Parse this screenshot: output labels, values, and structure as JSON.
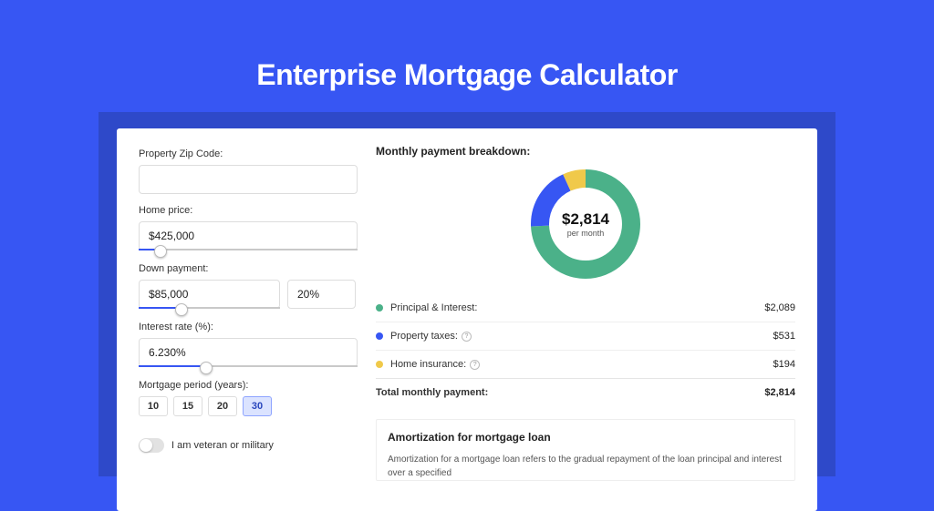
{
  "title": "Enterprise Mortgage Calculator",
  "form": {
    "zip": {
      "label": "Property Zip Code:",
      "value": ""
    },
    "price": {
      "label": "Home price:",
      "value": "$425,000",
      "slider_pct": 10
    },
    "down": {
      "label": "Down payment:",
      "amount": "$85,000",
      "pct": "20%",
      "slider_pct": 30
    },
    "rate": {
      "label": "Interest rate (%):",
      "value": "6.230%",
      "slider_pct": 31
    },
    "period": {
      "label": "Mortgage period (years):",
      "options": [
        "10",
        "15",
        "20",
        "30"
      ],
      "selected": "30"
    },
    "veteran": {
      "label": "I am veteran or military",
      "on": false
    }
  },
  "breakdown": {
    "title": "Monthly payment breakdown:",
    "center_amount": "$2,814",
    "center_sub": "per month",
    "items": [
      {
        "label": "Principal & Interest:",
        "value": "$2,089",
        "color": "#4bb189",
        "info": false
      },
      {
        "label": "Property taxes:",
        "value": "$531",
        "color": "#3756f3",
        "info": true
      },
      {
        "label": "Home insurance:",
        "value": "$194",
        "color": "#f0c94a",
        "info": true
      }
    ],
    "total": {
      "label": "Total monthly payment:",
      "value": "$2,814"
    }
  },
  "chart_data": {
    "type": "pie",
    "title": "Monthly payment breakdown",
    "series": [
      {
        "name": "Principal & Interest",
        "value": 2089,
        "color": "#4bb189"
      },
      {
        "name": "Property taxes",
        "value": 531,
        "color": "#3756f3"
      },
      {
        "name": "Home insurance",
        "value": 194,
        "color": "#f0c94a"
      }
    ],
    "total": 2814,
    "center_label": "$2,814 per month"
  },
  "amort": {
    "title": "Amortization for mortgage loan",
    "text": "Amortization for a mortgage loan refers to the gradual repayment of the loan principal and interest over a specified"
  }
}
